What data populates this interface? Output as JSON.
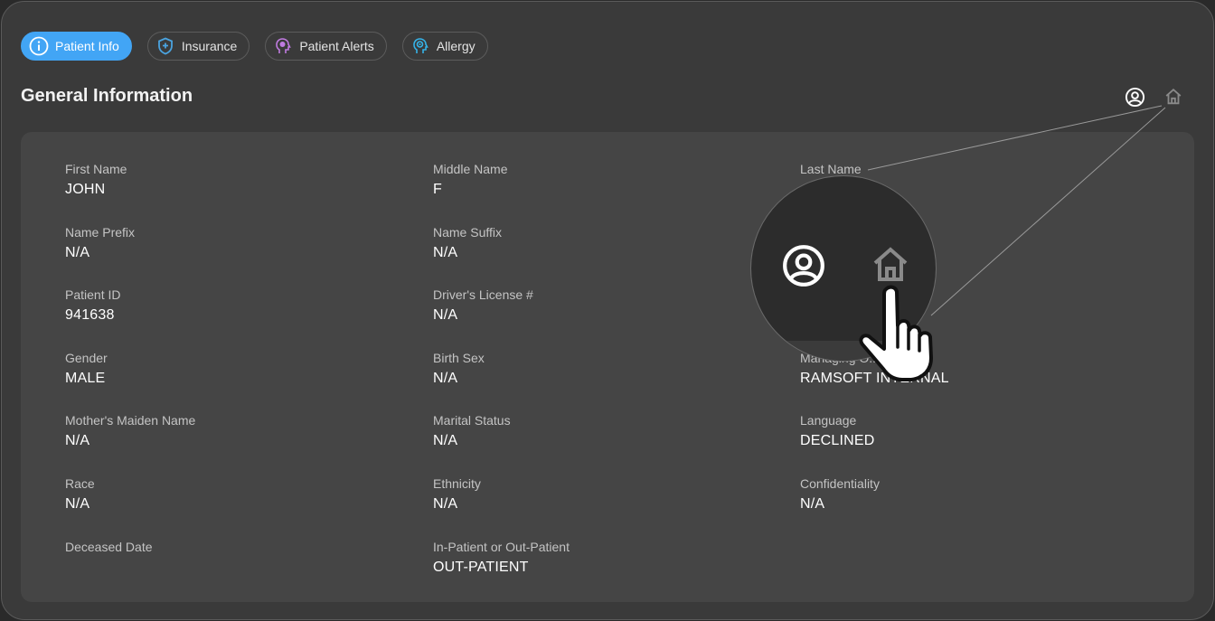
{
  "tabs": [
    {
      "label": "Patient Info",
      "icon": "info-icon",
      "active": true,
      "color": "#ffffff"
    },
    {
      "label": "Insurance",
      "icon": "shield-plus-icon",
      "active": false,
      "color": "#4aa3df"
    },
    {
      "label": "Patient Alerts",
      "icon": "head-alert-icon",
      "active": false,
      "color": "#c07be0"
    },
    {
      "label": "Allergy",
      "icon": "head-allergy-icon",
      "active": false,
      "color": "#35b3e8"
    }
  ],
  "section": {
    "title": "General Information"
  },
  "header_icons": [
    "user-circle-icon",
    "home-icon"
  ],
  "fields": {
    "first_name": {
      "label": "First Name",
      "value": "JOHN"
    },
    "middle_name": {
      "label": "Middle Name",
      "value": "F"
    },
    "last_name": {
      "label": "Last Name",
      "value": ""
    },
    "name_prefix": {
      "label": "Name Prefix",
      "value": "N/A"
    },
    "name_suffix": {
      "label": "Name Suffix",
      "value": "N/A"
    },
    "patient_id": {
      "label": "Patient ID",
      "value": "941638"
    },
    "drivers_license": {
      "label": "Driver's License #",
      "value": "N/A"
    },
    "gender": {
      "label": "Gender",
      "value": "MALE"
    },
    "birth_sex": {
      "label": "Birth Sex",
      "value": "N/A"
    },
    "managing_org": {
      "label": "Managing O...n",
      "value": "RAMSOFT INTERNAL"
    },
    "mothers_maiden_name": {
      "label": "Mother's Maiden Name",
      "value": "N/A"
    },
    "marital_status": {
      "label": "Marital Status",
      "value": "N/A"
    },
    "language": {
      "label": "Language",
      "value": "DECLINED"
    },
    "race": {
      "label": "Race",
      "value": "N/A"
    },
    "ethnicity": {
      "label": "Ethnicity",
      "value": "N/A"
    },
    "confidentiality": {
      "label": "Confidentiality",
      "value": "N/A"
    },
    "deceased_date": {
      "label": "Deceased Date",
      "value": ""
    },
    "inpatient_outpatient": {
      "label": "In-Patient or Out-Patient",
      "value": "OUT-PATIENT"
    }
  },
  "colors": {
    "accent": "#42a5f5",
    "background": "#3a3a3a",
    "card": "#454545"
  }
}
